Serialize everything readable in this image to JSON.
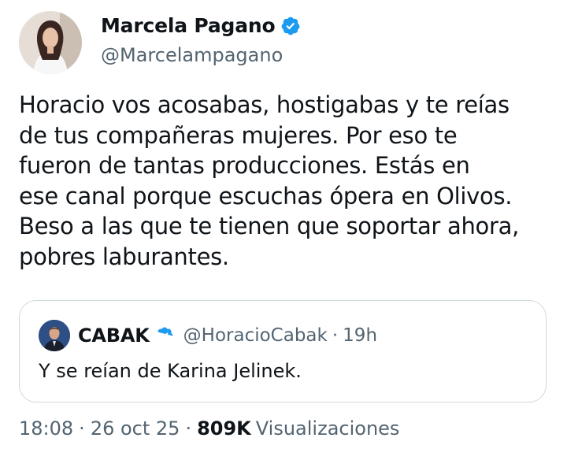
{
  "author": {
    "name": "Marcela Pagano",
    "handle": "@Marcelampagano",
    "verified": true
  },
  "tweet": {
    "text": "Horacio vos acosabas, hostigabas y te reías\nde tus compañeras mujeres. Por eso te\nfueron de tantas producciones. Estás en\nese canal porque escuchas ópera en Olivos.\nBeso a las que te tienen que soportar ahora,\npobres laburantes."
  },
  "quoted_tweet": {
    "name": "CABAK",
    "handle": "@HoracioCabak",
    "separator": "·",
    "time": "19h",
    "verified": true,
    "text": "Y se reían de Karina Jelinek."
  },
  "meta": {
    "time": "18:08",
    "separator": "·",
    "date": "26 oct 25",
    "views_count": "809K",
    "views_label": "Visualizaciones"
  },
  "colors": {
    "verified_blue": "#1d9bf0",
    "text_primary": "#0f1419",
    "text_secondary": "#536471",
    "border": "#cfd9de"
  }
}
